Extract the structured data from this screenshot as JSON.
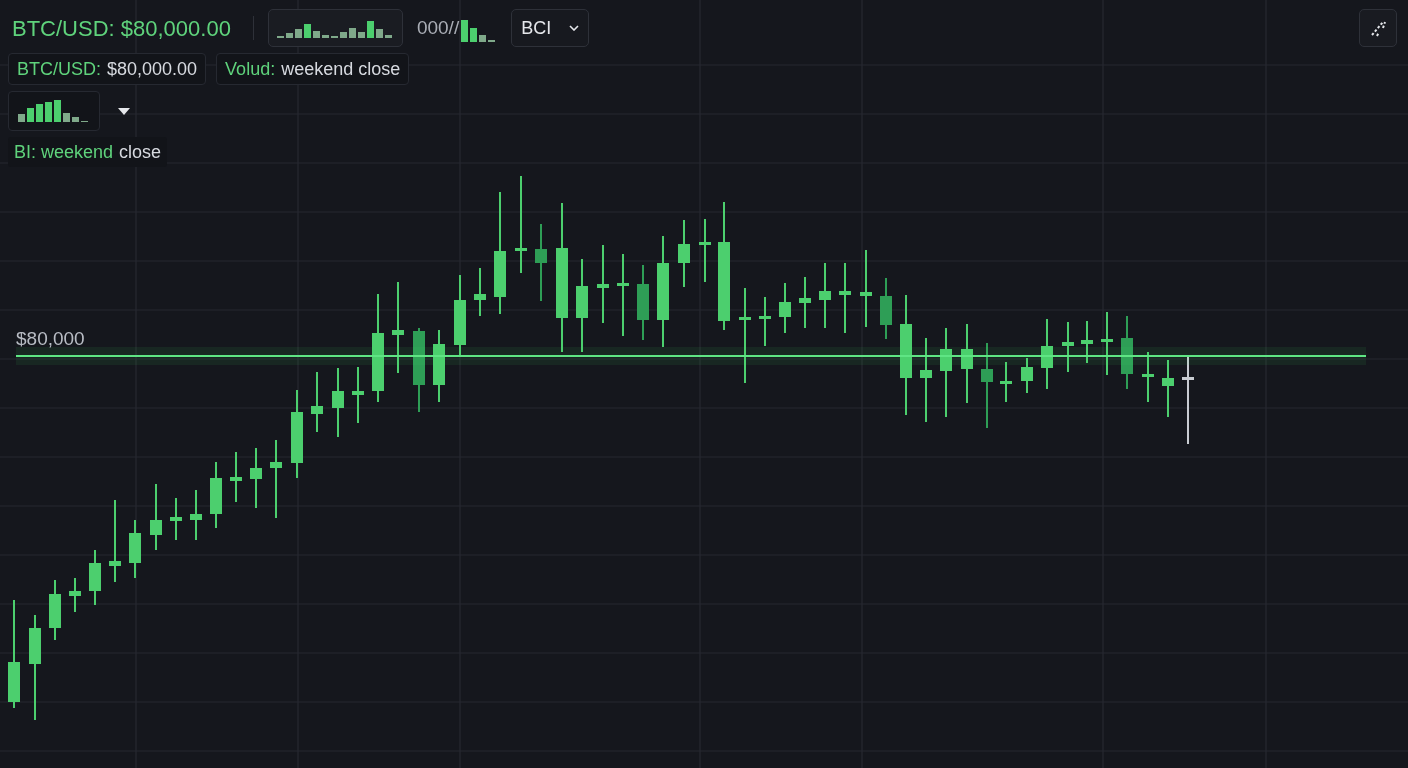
{
  "header": {
    "pair_price": "BTC/USD: $80,000.00",
    "counter": "000//",
    "symbol_select": {
      "value": "BCI"
    }
  },
  "chips": [
    {
      "label": "BTC/USD:",
      "value": "$80,000.00"
    },
    {
      "label": "Volud:",
      "value": "weekend close"
    }
  ],
  "note": {
    "highlight": "BI: weekend",
    "rest": "close"
  },
  "price_line": {
    "label": "$80,000"
  }
}
